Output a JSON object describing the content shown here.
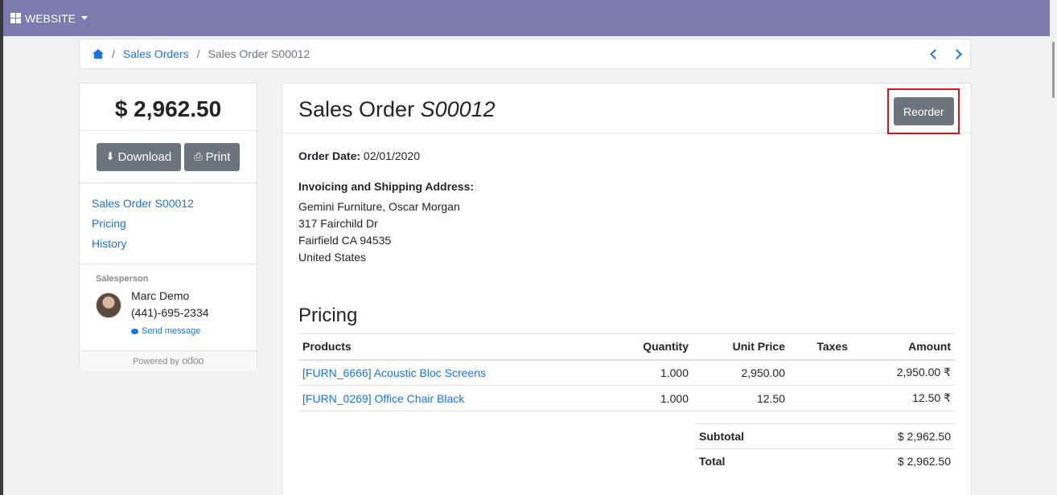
{
  "topbar": {
    "menu_label": "WEBSITE"
  },
  "breadcrumb": {
    "items": [
      "Sales Orders",
      "Sales Order S00012"
    ]
  },
  "sidebar": {
    "amount": "$ 2,962.50",
    "download_label": "Download",
    "print_label": "Print",
    "links": [
      "Sales Order S00012",
      "Pricing",
      "History"
    ],
    "salesperson_label": "Salesperson",
    "salesperson_name": "Marc Demo",
    "salesperson_phone": "(441)-695-2334",
    "send_message": "Send message",
    "powered_by": "Powered by",
    "brand": "odoo"
  },
  "order": {
    "title_prefix": "Sales Order",
    "number": "S00012",
    "reorder_label": "Reorder",
    "order_date_label": "Order Date:",
    "order_date": "02/01/2020",
    "address_label": "Invoicing and Shipping Address:",
    "address_lines": [
      "Gemini Furniture, Oscar Morgan",
      "317 Fairchild Dr",
      "Fairfield CA 94535",
      "United States"
    ]
  },
  "pricing": {
    "title": "Pricing",
    "columns": [
      "Products",
      "Quantity",
      "Unit Price",
      "Taxes",
      "Amount"
    ],
    "rows": [
      {
        "product": "[FURN_6666] Acoustic Bloc Screens",
        "qty": "1.000",
        "unit": "2,950.00",
        "taxes": "",
        "amount": "2,950.00 ₹"
      },
      {
        "product": "[FURN_0269] Office Chair Black",
        "qty": "1.000",
        "unit": "12.50",
        "taxes": "",
        "amount": "12.50 ₹"
      }
    ],
    "subtotal_label": "Subtotal",
    "subtotal": "$ 2,962.50",
    "total_label": "Total",
    "total": "$ 2,962.50"
  },
  "colors": {
    "topbar": "#7c7bad",
    "link": "#1a73e8",
    "button": "#6c757d",
    "highlight": "#d9141e"
  }
}
